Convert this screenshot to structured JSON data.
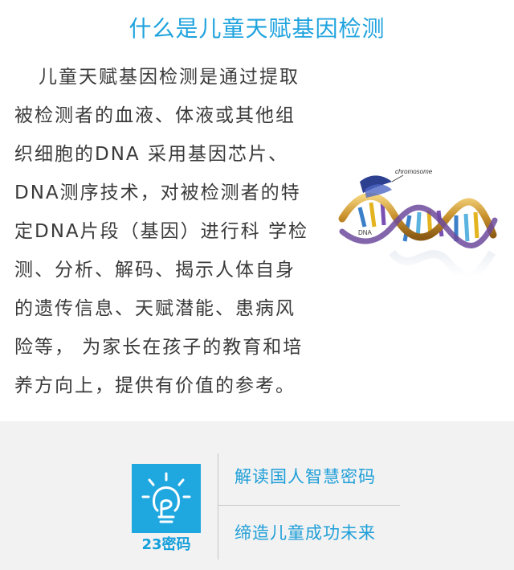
{
  "title": "什么是儿童天赋基因检测",
  "paragraph_lines": [
    "儿童天赋基因检测是通过提取",
    "被检测者的血液、体液或其他组",
    "织细胞的DNA 采用基因芯片、",
    "DNA测序技术，对被检测者的特",
    "定DNA片段（基因）进行科 学检",
    "测、分析、解码、揭示人体自身",
    "的遗传信息、天赋潜能、患病风",
    "险等， 为家长在孩子的教育和培",
    "养方向上，提供有价值的参考。"
  ],
  "dna_image": {
    "label_chromosome": "chromosome",
    "label_dna": "DNA"
  },
  "footer": {
    "logo_caption": "23密码",
    "slogan_1": "解读国人智慧密码",
    "slogan_2": "缔造儿童成功未来"
  },
  "colors": {
    "accent": "#1fa3de",
    "footer_bg": "#f2f2f2",
    "body_text": "#3a3a3a"
  }
}
